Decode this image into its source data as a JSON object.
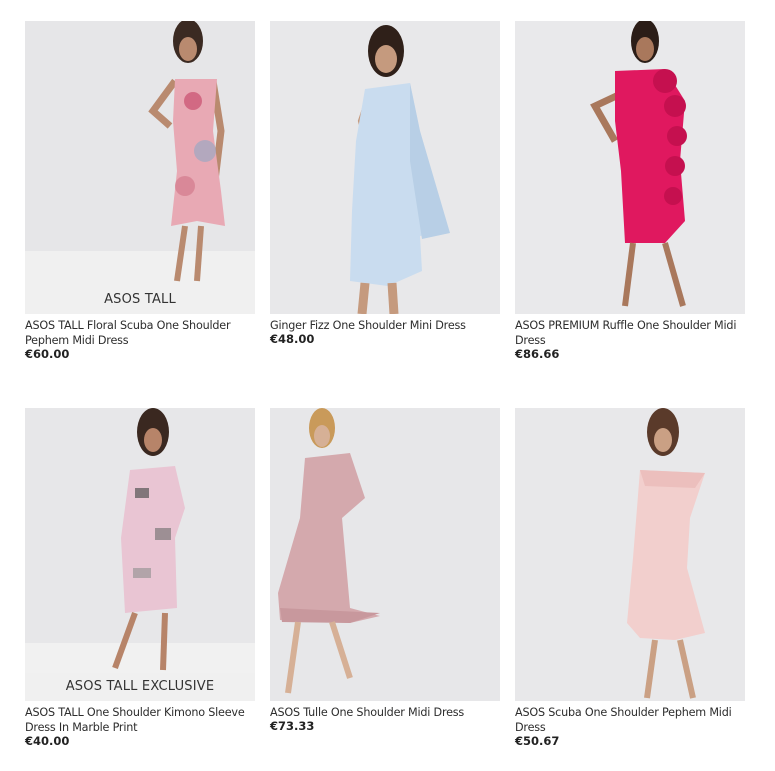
{
  "products": [
    {
      "name": "ASOS TALL Floral Scuba One Shoulder Pephem Midi Dress",
      "price": "€60.00",
      "banner": "ASOS TALL",
      "image": "model in floral one-shoulder midi dress"
    },
    {
      "name": "Ginger Fizz One Shoulder Mini Dress",
      "price": "€48.00",
      "banner": "",
      "image": "model in pale blue one-shoulder mini dress with flared sleeve"
    },
    {
      "name": "ASOS PREMIUM Ruffle One Shoulder Midi Dress",
      "price": "€86.66",
      "banner": "",
      "image": "model in pink ruffle one-shoulder midi dress"
    },
    {
      "name": "ASOS TALL One Shoulder Kimono Sleeve Dress In Marble Print",
      "price": "€40.00",
      "banner": "ASOS TALL EXCLUSIVE",
      "image": "model in marble print kimono sleeve dress"
    },
    {
      "name": "ASOS Tulle One Shoulder Midi Dress",
      "price": "€73.33",
      "banner": "",
      "image": "model in dusty pink tulle midi dress"
    },
    {
      "name": "ASOS Scuba One Shoulder Pephem Midi Dress",
      "price": "€50.67",
      "banner": "",
      "image": "model in blush scuba one-shoulder pephem midi dress"
    }
  ],
  "colors": {
    "dress_1": "#e8a9b4",
    "dress_2": "#c9dcef",
    "dress_3": "#e0185f",
    "dress_4": "#e9c5d3",
    "dress_5": "#d4a9ad",
    "dress_6": "#f2cfcd"
  }
}
